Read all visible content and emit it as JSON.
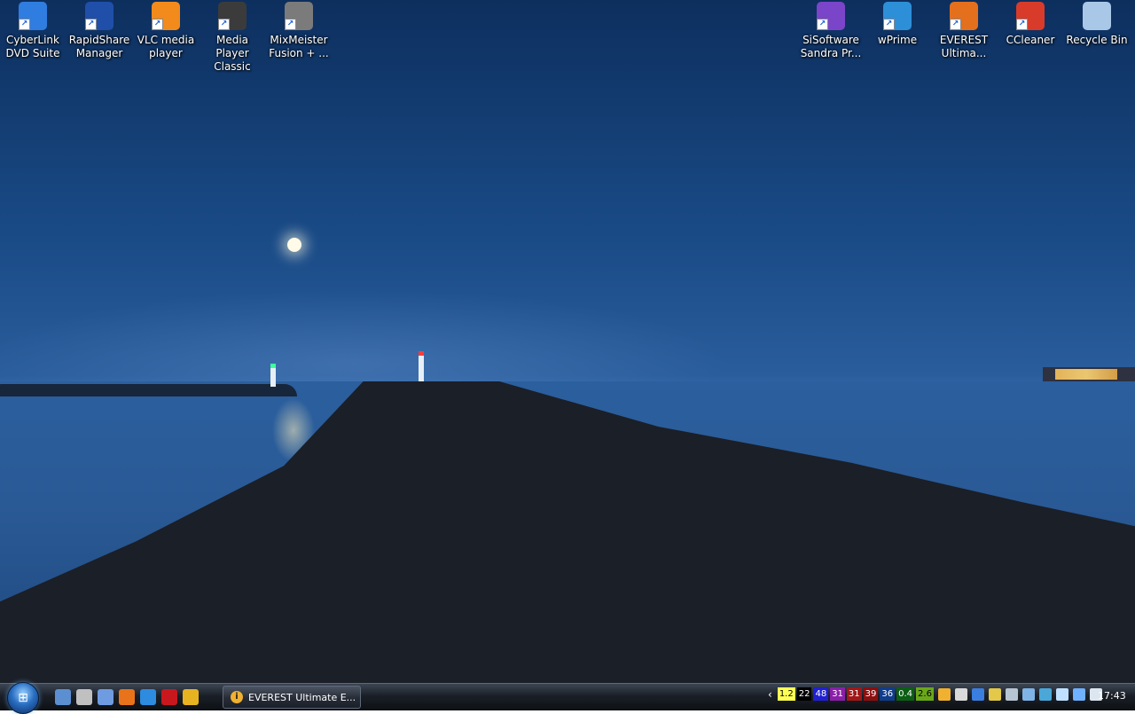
{
  "desktop_icons": [
    {
      "label": "CyberLink DVD Suite",
      "icon": "cyberlink-icon",
      "color": "#2f7de0"
    },
    {
      "label": "RapidShare Manager",
      "icon": "rapidshare-icon",
      "color": "#1f4fa8"
    },
    {
      "label": "VLC media player",
      "icon": "vlc-cone-icon",
      "color": "#f28a1c"
    },
    {
      "label": "Media Player Classic",
      "icon": "mpc-icon",
      "color": "#3b3b3b"
    },
    {
      "label": "MixMeister Fusion + ...",
      "icon": "mixmeister-icon",
      "color": "#7b7b7b"
    },
    {
      "label": "SiSoftware Sandra Pr...",
      "icon": "sisoftware-icon",
      "color": "#7a45c9"
    },
    {
      "label": "wPrime",
      "icon": "wprime-icon",
      "color": "#2d8fd8"
    },
    {
      "label": "EVEREST Ultima...",
      "icon": "everest-icon",
      "color": "#e46f1c"
    },
    {
      "label": "CCleaner",
      "icon": "ccleaner-icon",
      "color": "#d83b2a"
    },
    {
      "label": "Recycle Bin",
      "icon": "recycle-bin-icon",
      "color": "#a9c7e6"
    }
  ],
  "taskbar": {
    "quick_launch": [
      {
        "icon": "show-desktop-icon",
        "color": "#5b8fd2"
      },
      {
        "icon": "utility-icon",
        "color": "#c0c0c0"
      },
      {
        "icon": "window-switcher-icon",
        "color": "#6f9be0"
      },
      {
        "icon": "firefox-icon",
        "color": "#e8731a"
      },
      {
        "icon": "internet-explorer-icon",
        "color": "#2d8be0"
      },
      {
        "icon": "opera-icon",
        "color": "#c8181e"
      },
      {
        "icon": "chrome-icon",
        "color": "#e7b321"
      }
    ],
    "task_button": {
      "label": "EVEREST Ultimate E...",
      "icon": "everest-icon",
      "icon_glyph": "i"
    },
    "tray_arrow": "‹",
    "tray_badges": [
      {
        "text": "1.2",
        "bg": "#ffff55",
        "fg": "#000000"
      },
      {
        "text": "22",
        "bg": "#000000",
        "fg": "#ffffff"
      },
      {
        "text": "48",
        "bg": "#2020d0",
        "fg": "#ffffff"
      },
      {
        "text": "31",
        "bg": "#8a1fa8",
        "fg": "#ffffff"
      },
      {
        "text": "31",
        "bg": "#a01818",
        "fg": "#ffffff"
      },
      {
        "text": "39",
        "bg": "#8a0f0f",
        "fg": "#ffffff"
      },
      {
        "text": "36",
        "bg": "#103d8a",
        "fg": "#ffffff"
      },
      {
        "text": "0.4",
        "bg": "#0b5e14",
        "fg": "#ffffff"
      },
      {
        "text": "2.6",
        "bg": "#6aa81a",
        "fg": "#000000"
      }
    ],
    "tray_icons": [
      {
        "icon": "info-icon",
        "color": "#f0b030"
      },
      {
        "icon": "network-monitor-icon",
        "color": "#d9d9d9"
      },
      {
        "icon": "bluetooth-icon",
        "color": "#3a7fe0"
      },
      {
        "icon": "pen-icon",
        "color": "#e3c84a"
      },
      {
        "icon": "monitor-icon",
        "color": "#b7c4d2"
      },
      {
        "icon": "settings-icon",
        "color": "#7fb3e6"
      },
      {
        "icon": "help-icon",
        "color": "#4aa7d8"
      },
      {
        "icon": "safely-remove-icon",
        "color": "#bfe1ff"
      },
      {
        "icon": "network-icon",
        "color": "#6fb0ff"
      },
      {
        "icon": "volume-icon",
        "color": "#dce6f0"
      }
    ],
    "clock": "17:43"
  }
}
